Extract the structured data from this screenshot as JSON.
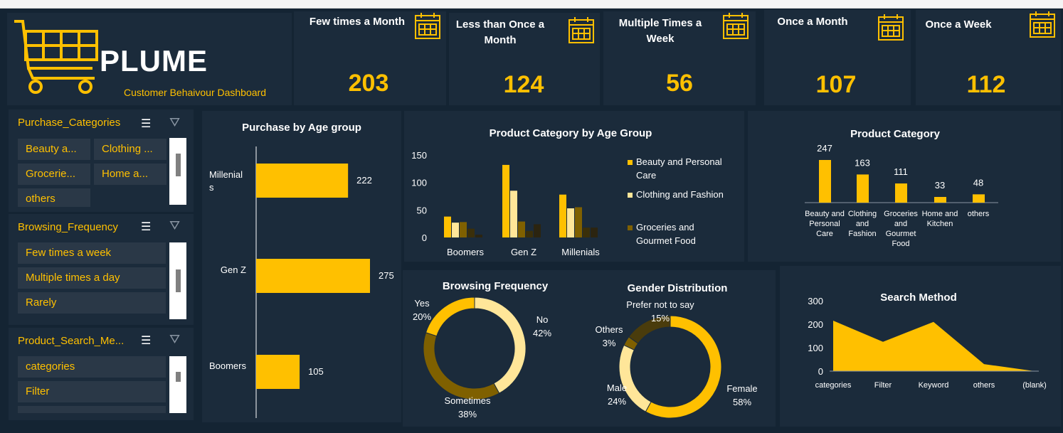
{
  "brand": {
    "title": "PLUME",
    "subtitle": "Customer Behaivour Dashboard"
  },
  "colors": {
    "accent": "#ffc000",
    "panel": "#1b2b3b",
    "background": "#142433",
    "light_yellow": "#ffe699",
    "dark_olive": "#7f6000",
    "darker": "#3a2f0a"
  },
  "kpis": [
    {
      "title": "Few times a Month",
      "value": "203",
      "icon": "calendar-icon"
    },
    {
      "title": "Less than Once  a Month",
      "value": "124",
      "icon": "calendar-icon"
    },
    {
      "title": "Multiple Times a Week",
      "value": "56",
      "icon": "calendar-icon"
    },
    {
      "title": "Once  a Month",
      "value": "107",
      "icon": "calendar-icon"
    },
    {
      "title": "Once  a Week",
      "value": "112",
      "icon": "calendar-icon"
    }
  ],
  "slicers": {
    "purchase": {
      "title": "Purchase_Categories",
      "items": [
        "Beauty a...",
        "Clothing ...",
        "Grocerie...",
        "Home a...",
        "others"
      ]
    },
    "browsing": {
      "title": "Browsing_Frequency",
      "items": [
        "Few times a week",
        "Multiple times a day",
        "Rarely"
      ]
    },
    "search": {
      "title": "Product_Search_Me...",
      "items": [
        "categories",
        "Filter"
      ]
    }
  },
  "chart_data": [
    {
      "type": "bar",
      "orientation": "horizontal",
      "title": "Purchase by Age group",
      "categories": [
        "Millenials",
        "Gen Z",
        "Boomers"
      ],
      "values": [
        222,
        275,
        105
      ]
    },
    {
      "type": "bar",
      "title": "Product Category by Age Group",
      "categories": [
        "Boomers",
        "Gen Z",
        "Millenials"
      ],
      "yticks": [
        "150",
        "100",
        "50",
        "0"
      ],
      "ylim": [
        0,
        150
      ],
      "legend_position": "right",
      "series": [
        {
          "name": "Beauty and Personal Care",
          "values": [
            38,
            132,
            78
          ]
        },
        {
          "name": "Clothing and Fashion",
          "values": [
            27,
            85,
            53
          ]
        },
        {
          "name": "",
          "values": [
            28,
            29,
            55
          ]
        },
        {
          "name": "Groceries and Gourmet Food",
          "values": [
            16,
            12,
            18
          ]
        },
        {
          "name": "",
          "values": [
            5,
            24,
            18
          ]
        }
      ]
    },
    {
      "type": "bar",
      "title": "Product Category",
      "categories": [
        "Beauty and Personal Care",
        "Clothing and Fashion",
        "Groceries and Gourmet Food",
        "Home and Kitchen",
        "others"
      ],
      "values": [
        247,
        163,
        111,
        33,
        48
      ]
    },
    {
      "type": "pie",
      "title": "Browsing Frequency",
      "series": [
        {
          "name": "No",
          "value": 42,
          "label": "42%"
        },
        {
          "name": "Sometimes",
          "value": 38,
          "label": "38%"
        },
        {
          "name": "Yes",
          "value": 20,
          "label": "20%"
        }
      ]
    },
    {
      "type": "pie",
      "title": "Gender Distribution",
      "series": [
        {
          "name": "Female",
          "value": 58,
          "label": "58%"
        },
        {
          "name": "Male",
          "value": 24,
          "label": "24%"
        },
        {
          "name": "Others",
          "value": 3,
          "label": "3%"
        },
        {
          "name": "Prefer not to say",
          "value": 15,
          "label": "15%"
        }
      ]
    },
    {
      "type": "area",
      "title": "Search Method",
      "categories": [
        "categories",
        "Filter",
        "Keyword",
        "others",
        "(blank)"
      ],
      "values": [
        215,
        125,
        210,
        30,
        0
      ],
      "yticks": [
        "300",
        "200",
        "100",
        "0"
      ],
      "ylim": [
        0,
        300
      ]
    }
  ]
}
